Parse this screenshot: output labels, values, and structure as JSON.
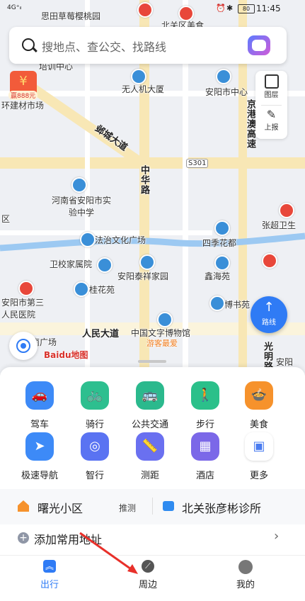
{
  "statusbar": {
    "network": "4G⁺ᵢₗ",
    "battery": "80",
    "time": "11:45"
  },
  "search": {
    "placeholder": "搜地点、查公交、找路线"
  },
  "map": {
    "labels": {
      "top_area": "思田草莓樱桃园",
      "top_right": "北关区美食",
      "training": "培训中心",
      "building_market": "环建材市场",
      "drone_tower": "无人机大厦",
      "city_center": "安阳市中心",
      "jingangao": "京港澳高速",
      "yecheng": "邺城大道",
      "s301": "S301",
      "zhonghua": "中华路",
      "henan_school": "河南省安阳市实验中学",
      "zhangzhao": "张超卫生",
      "fazhi": "法治文化广场",
      "siji": "四季花都",
      "weixiao": "卫校家属院",
      "tairui": "安阳泰祥家园",
      "xinhai": "鑫海苑",
      "guihua": "桂花苑",
      "hospital": "安阳市第三人民医院",
      "bowen": "博书苑",
      "renmin": "人民大道",
      "museum": "中国文字博物馆",
      "youke": "游客最爱",
      "guangchang": "南广场",
      "guangming": "光明路",
      "anyang_right": "安阳",
      "logo": "Baidu地图",
      "zone": "区"
    },
    "red_envelope": "赢888元"
  },
  "tools": {
    "layers": "图层",
    "report": "上报"
  },
  "route_button": "路线",
  "services": [
    {
      "label": "驾车",
      "icon": "car-icon",
      "color": "#3d8af7"
    },
    {
      "label": "骑行",
      "icon": "bike-icon",
      "color": "#2dbf8f"
    },
    {
      "label": "公共交通",
      "icon": "bus-icon",
      "color": "#2bb98d"
    },
    {
      "label": "步行",
      "icon": "walk-icon",
      "color": "#2bc08a"
    },
    {
      "label": "美食",
      "icon": "food-icon",
      "color": "#f6922c"
    },
    {
      "label": "极速导航",
      "icon": "navigation-icon",
      "color": "#3d8af7"
    },
    {
      "label": "智行",
      "icon": "smart-travel-icon",
      "color": "#5a73f2"
    },
    {
      "label": "测距",
      "icon": "ruler-icon",
      "color": "#6a70f0"
    },
    {
      "label": "酒店",
      "icon": "hotel-icon",
      "color": "#7b68e8"
    },
    {
      "label": "更多",
      "icon": "more-apps-icon",
      "color": "#ffffff"
    }
  ],
  "addresses": {
    "home": "曙光小区",
    "tag": "推测",
    "work": "北关张彦彬诊所",
    "add_common": "添加常用地址"
  },
  "tabs": [
    {
      "label": "出行"
    },
    {
      "label": "周边"
    },
    {
      "label": "我的"
    }
  ]
}
